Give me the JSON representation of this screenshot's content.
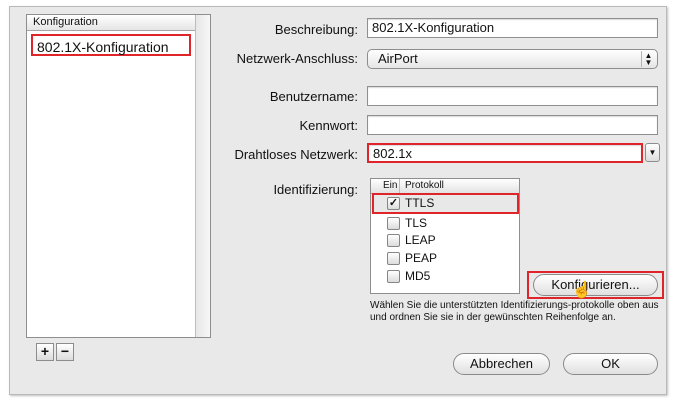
{
  "sidebar": {
    "header": "Konfiguration",
    "items": [
      {
        "label": "802.1X-Konfiguration"
      }
    ],
    "add_label": "+",
    "remove_label": "−"
  },
  "form": {
    "description": {
      "label": "Beschreibung:",
      "value": "802.1X-Konfiguration"
    },
    "port": {
      "label": "Netzwerk-Anschluss:",
      "value": "AirPort"
    },
    "username": {
      "label": "Benutzername:",
      "value": ""
    },
    "password": {
      "label": "Kennwort:",
      "value": ""
    },
    "wireless": {
      "label": "Drahtloses Netzwerk:",
      "value": "802.1x"
    },
    "auth": {
      "label": "Identifizierung:"
    }
  },
  "protocol_table": {
    "col_enabled": "Ein",
    "col_protocol": "Protokoll",
    "rows": [
      {
        "name": "TTLS",
        "checked": "✓"
      },
      {
        "name": "TLS",
        "checked": ""
      },
      {
        "name": "LEAP",
        "checked": ""
      },
      {
        "name": "PEAP",
        "checked": ""
      },
      {
        "name": "MD5",
        "checked": ""
      }
    ]
  },
  "configure_button": "Konfigurieren...",
  "hint_text": "Wählen Sie die unterstützten Identifizierungs-protokolle oben aus und ordnen Sie sie in der gewünschten Reihenfolge an.",
  "buttons": {
    "cancel": "Abbrechen",
    "ok": "OK"
  },
  "colors": {
    "highlight": "#e0252a",
    "background": "#e9e9e9"
  }
}
